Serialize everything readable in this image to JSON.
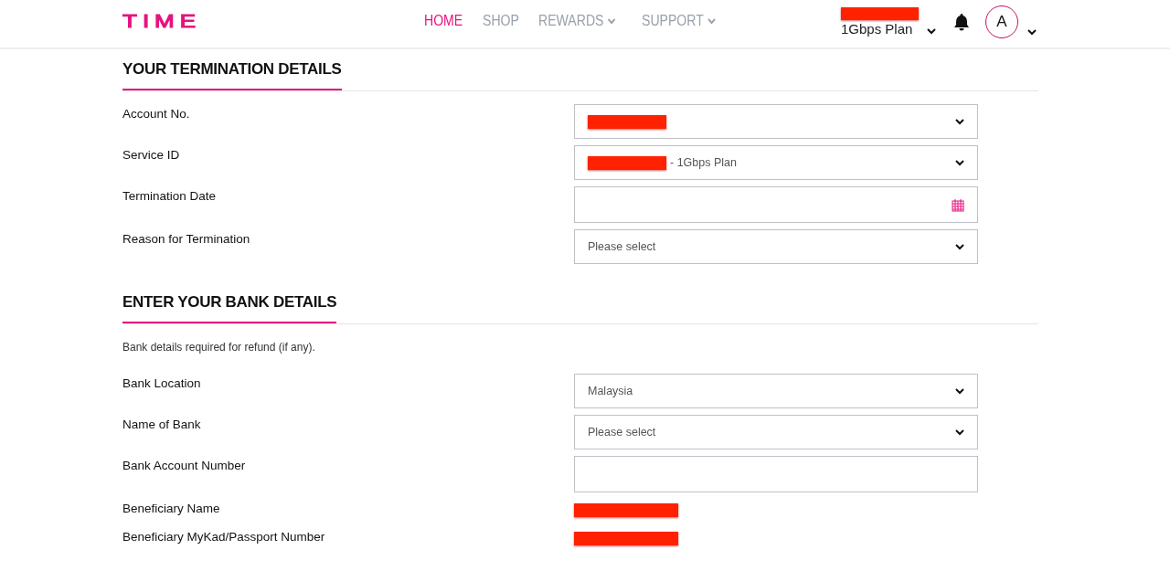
{
  "header": {
    "logo": "TIME",
    "nav": [
      {
        "label": "HOME",
        "selected": true,
        "dropdown": false
      },
      {
        "label": "SHOP",
        "selected": false,
        "dropdown": false
      },
      {
        "label": "REWARDS",
        "selected": false,
        "dropdown": true
      },
      {
        "label": "SUPPORT",
        "selected": false,
        "dropdown": true
      }
    ],
    "account": {
      "redacted": true,
      "plan": "1Gbps Plan"
    },
    "avatar": "A"
  },
  "sections": [
    {
      "title": "YOUR TERMINATION DETAILS",
      "fields": [
        {
          "label": "Account No.",
          "kind": "select",
          "redacted": true
        },
        {
          "label": "Service ID",
          "kind": "select",
          "redacted": true,
          "value": "- 1Gbps Plan"
        },
        {
          "label": "Termination Date",
          "kind": "date",
          "redacted": false
        },
        {
          "label": "Reason for Termination",
          "kind": "select",
          "redacted": false,
          "placeholder": "Please select"
        }
      ]
    },
    {
      "title": "ENTER YOUR BANK DETAILS",
      "note": "Bank details required for refund (if any).",
      "fields": [
        {
          "label": "Bank Location",
          "kind": "select",
          "redacted": false,
          "value": "Malaysia"
        },
        {
          "label": "Name of Bank",
          "kind": "select",
          "redacted": false,
          "placeholder": "Please select"
        },
        {
          "label": "Bank Account Number",
          "kind": "text",
          "redacted": false
        },
        {
          "label": "Beneficiary Name",
          "kind": "static",
          "redacted": true
        },
        {
          "label": "Beneficiary MyKad/Passport Number",
          "kind": "static",
          "redacted": true
        }
      ]
    }
  ]
}
